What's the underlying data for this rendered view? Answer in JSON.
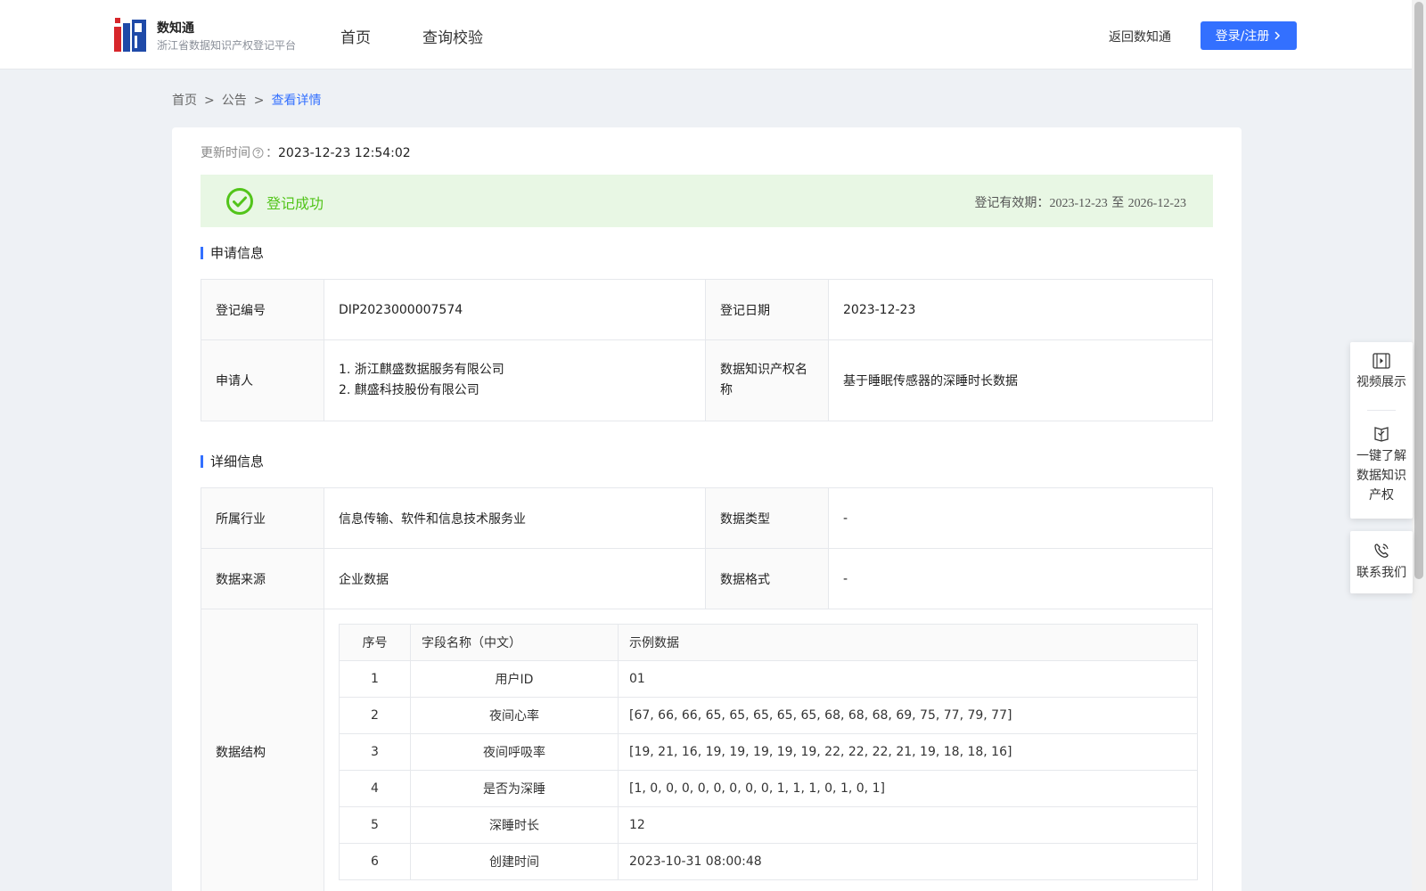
{
  "header": {
    "brand_name": "数知通",
    "brand_sub": "浙江省数据知识产权登记平台",
    "nav": [
      {
        "label": "首页"
      },
      {
        "label": "查询校验"
      }
    ],
    "back_link": "返回数知通",
    "login_label": "登录/注册"
  },
  "breadcrumb": {
    "items": [
      "首页",
      "公告"
    ],
    "current": "查看详情",
    "separator": ">"
  },
  "update": {
    "label": "更新时间",
    "colon": "：",
    "value": "2023-12-23 12:54:02"
  },
  "status": {
    "text": "登记成功",
    "validity_label": "登记有效期：",
    "validity_start": "2023-12-23",
    "validity_to": "至",
    "validity_end": "2026-12-23",
    "color": "#52c41a"
  },
  "application": {
    "title": "申请信息",
    "reg_no_label": "登记编号",
    "reg_no": "DIP2023000007574",
    "reg_date_label": "登记日期",
    "reg_date": "2023-12-23",
    "applicant_label": "申请人",
    "applicants": [
      "1. 浙江麒盛数据服务有限公司",
      "2. 麒盛科技股份有限公司"
    ],
    "ip_name_label": "数据知识产权名称",
    "ip_name": "基于睡眠传感器的深睡时长数据"
  },
  "detail": {
    "title": "详细信息",
    "industry_label": "所属行业",
    "industry": "信息传输、软件和信息技术服务业",
    "data_type_label": "数据类型",
    "data_type": "-",
    "source_label": "数据来源",
    "source": "企业数据",
    "format_label": "数据格式",
    "format": "-",
    "structure_label": "数据结构",
    "structure": {
      "headers": [
        "序号",
        "字段名称（中文）",
        "示例数据"
      ],
      "rows": [
        [
          "1",
          "用户ID",
          "01"
        ],
        [
          "2",
          "夜间心率",
          "[67, 66, 66, 65, 65, 65, 65, 65, 68, 68, 68, 69, 75, 77, 79, 77]"
        ],
        [
          "3",
          "夜间呼吸率",
          "[19, 21, 16, 19, 19, 19, 19, 19, 22, 22, 22, 21, 19, 18, 18, 16]"
        ],
        [
          "4",
          "是否为深睡",
          "[1, 0, 0, 0, 0, 0, 0, 0, 0, 1, 1, 1, 0, 1, 0, 1]"
        ],
        [
          "5",
          "深睡时长",
          "12"
        ],
        [
          "6",
          "创建时间",
          "2023-10-31 08:00:48"
        ]
      ]
    }
  },
  "float_panel": {
    "video": "视频展示",
    "learn": [
      "一键了解",
      "数据知识",
      "产权"
    ],
    "contact": "联系我们"
  },
  "colors": {
    "accent": "#3370ff",
    "success": "#52c41a",
    "success_bg": "#e8f7e4",
    "page_bg": "#eef1f5"
  }
}
